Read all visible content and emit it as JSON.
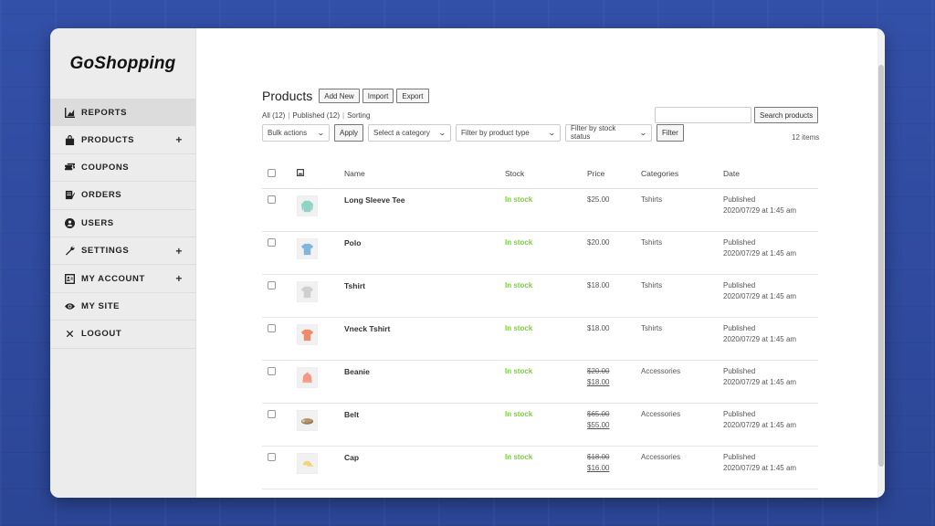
{
  "brand": "GoShopping",
  "nav": [
    {
      "label": "REPORTS",
      "icon": "chart-icon",
      "plus": false,
      "active": true
    },
    {
      "label": "PRODUCTS",
      "icon": "bag-icon",
      "plus": true,
      "active": false
    },
    {
      "label": "COUPONS",
      "icon": "coupons-icon",
      "plus": false,
      "active": false
    },
    {
      "label": "ORDERS",
      "icon": "orders-icon",
      "plus": false,
      "active": false
    },
    {
      "label": "USERS",
      "icon": "users-icon",
      "plus": false,
      "active": false
    },
    {
      "label": "SETTINGS",
      "icon": "wrench-icon",
      "plus": true,
      "active": false
    },
    {
      "label": "MY ACCOUNT",
      "icon": "account-icon",
      "plus": true,
      "active": false
    },
    {
      "label": "MY SITE",
      "icon": "eye-icon",
      "plus": false,
      "active": false
    },
    {
      "label": "LOGOUT",
      "icon": "close-icon",
      "plus": false,
      "active": false
    }
  ],
  "plus_symbol": "+",
  "page": {
    "title": "Products",
    "add_new": "Add New",
    "import": "Import",
    "export": "Export"
  },
  "subsub": {
    "all": "All (12)",
    "published": "Published (12)",
    "sorting": "Sorting",
    "sep": "|"
  },
  "filters": {
    "bulk_actions": "Bulk actions",
    "apply": "Apply",
    "category": "Select a category",
    "product_type": "Filter by product type",
    "stock_status": "Filter by stock status",
    "filter": "Filter"
  },
  "search": {
    "button": "Search products",
    "value": ""
  },
  "items_count": "12 items",
  "table": {
    "headers": {
      "name": "Name",
      "stock": "Stock",
      "price": "Price",
      "categories": "Categories",
      "date": "Date"
    },
    "rows": [
      {
        "name": "Long Sleeve Tee",
        "stock": "In stock",
        "price": "$25.00",
        "sale": "",
        "category": "Tshirts",
        "status": "Published",
        "date": "2020/07/29 at 1:45 am",
        "color": "#8fd3c2",
        "icon": "longsleeve-tee-icon"
      },
      {
        "name": "Polo",
        "stock": "In stock",
        "price": "$20.00",
        "sale": "",
        "category": "Tshirts",
        "status": "Published",
        "date": "2020/07/29 at 1:45 am",
        "color": "#7fb6de",
        "icon": "polo-shirt-icon"
      },
      {
        "name": "Tshirt",
        "stock": "In stock",
        "price": "$18.00",
        "sale": "",
        "category": "Tshirts",
        "status": "Published",
        "date": "2020/07/29 at 1:45 am",
        "color": "#cfcfcf",
        "icon": "tshirt-icon"
      },
      {
        "name": "Vneck Tshirt",
        "stock": "In stock",
        "price": "$18.00",
        "sale": "",
        "category": "Tshirts",
        "status": "Published",
        "date": "2020/07/29 at 1:45 am",
        "color": "#f08a6b",
        "icon": "vneck-tshirt-icon"
      },
      {
        "name": "Beanie",
        "stock": "In stock",
        "price": "$20.00",
        "sale": "$18.00",
        "category": "Accessories",
        "status": "Published",
        "date": "2020/07/29 at 1:45 am",
        "color": "#f29a86",
        "icon": "beanie-icon"
      },
      {
        "name": "Belt",
        "stock": "In stock",
        "price": "$65.00",
        "sale": "$55.00",
        "category": "Accessories",
        "status": "Published",
        "date": "2020/07/29 at 1:45 am",
        "color": "#9a7a58",
        "icon": "belt-icon"
      },
      {
        "name": "Cap",
        "stock": "In stock",
        "price": "$18.00",
        "sale": "$16.00",
        "category": "Accessories",
        "status": "Published",
        "date": "2020/07/29 at 1:45 am",
        "color": "#f2d37a",
        "icon": "cap-icon"
      }
    ]
  },
  "colors": {
    "in_stock": "#7ad03a",
    "background": "#2e4a9c",
    "sidebar": "#ececec"
  }
}
